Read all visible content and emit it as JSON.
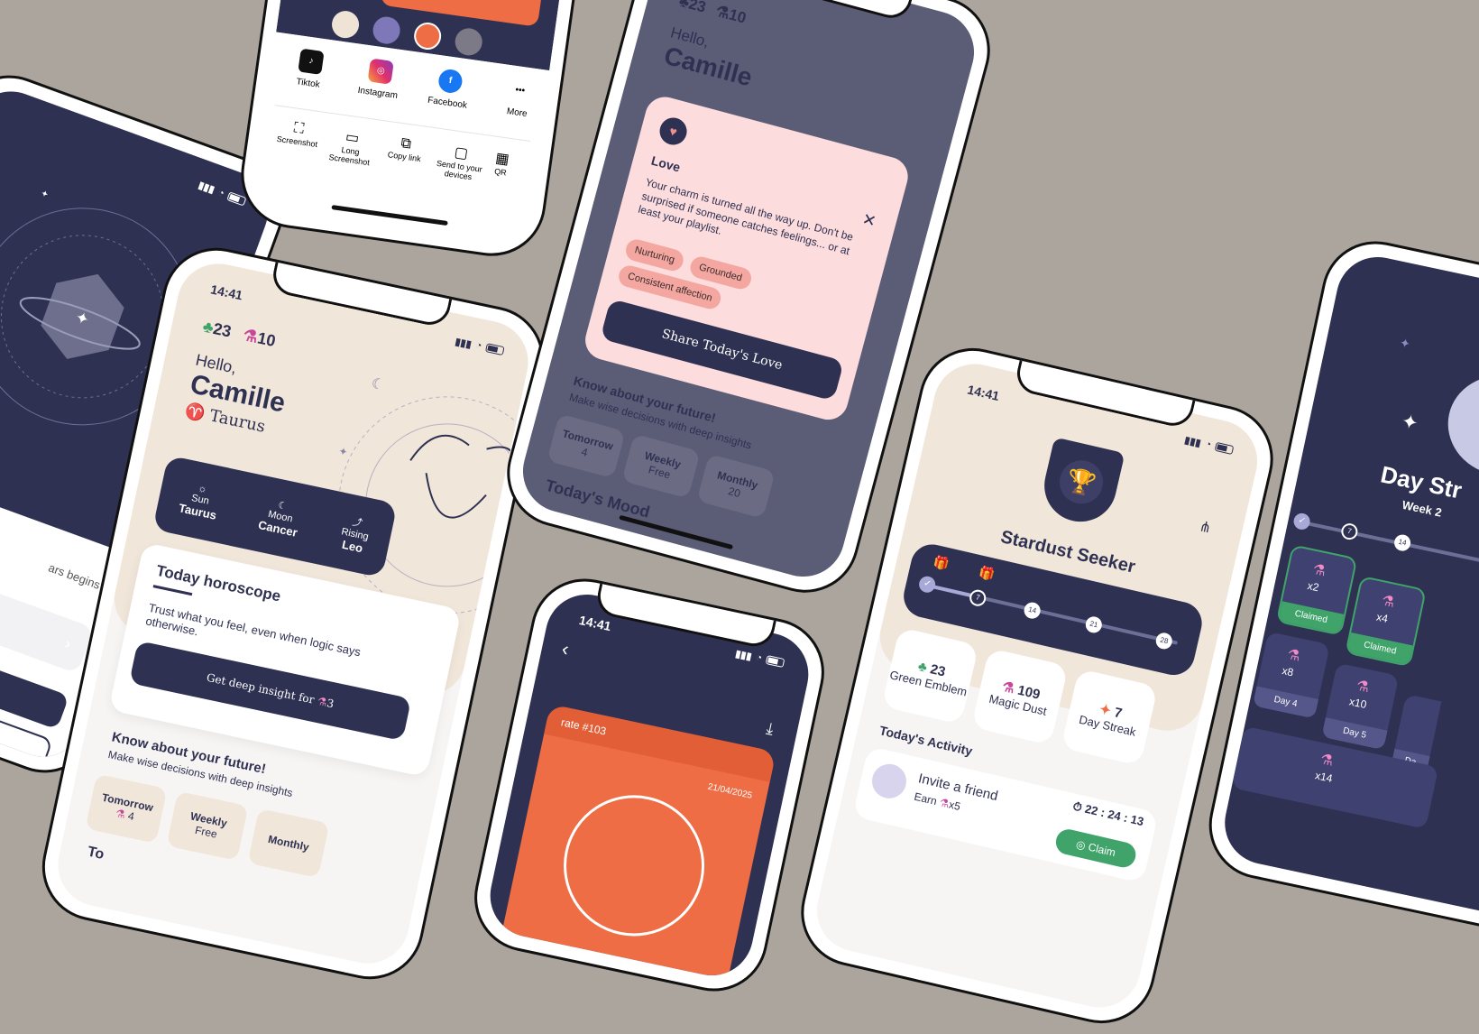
{
  "phone_left": {},
  "share_sheet": {
    "apps": [
      {
        "label": "Tiktok",
        "icon": "tiktok-icon"
      },
      {
        "label": "Instagram",
        "icon": "instagram-icon"
      },
      {
        "label": "Facebook",
        "icon": "facebook-icon"
      },
      {
        "label": "More",
        "icon": "more-icon"
      }
    ],
    "actions": [
      {
        "label": "Screenshot",
        "icon": "screenshot-icon"
      },
      {
        "label": "Long Screenshot",
        "icon": "long-screenshot-icon"
      },
      {
        "label": "Copy link",
        "icon": "copy-link-icon"
      },
      {
        "label": "Send to your devices",
        "icon": "devices-icon"
      },
      {
        "label": "QR",
        "icon": "qr-icon"
      }
    ],
    "swatches": [
      "#efe3d6",
      "#7e78b8",
      "#ee6d45",
      "#7c7a86"
    ]
  },
  "home": {
    "time": "14:41",
    "gems": "23",
    "dust": "10",
    "greeting": "Hello,",
    "name": "Camille",
    "sign": "Taurus",
    "signs": [
      {
        "label": "Sun",
        "value": "Taurus"
      },
      {
        "label": "Moon",
        "value": "Cancer"
      },
      {
        "label": "Rising",
        "value": "Leo"
      }
    ],
    "horoscope_title": "Today horoscope",
    "horoscope_text": "Trust what you feel, even when logic says otherwise.",
    "insight_button": "Get deep insight for",
    "insight_cost": "3",
    "future_title": "Know about your future!",
    "future_sub": "Make wise decisions with deep insights",
    "future_cards": [
      {
        "label": "Tomorrow",
        "value": "4"
      },
      {
        "label": "Weekly",
        "value": "Free"
      },
      {
        "label": "Monthly",
        "value": ""
      }
    ],
    "footer_partial": "To"
  },
  "love_modal": {
    "gems": "23",
    "dust": "10",
    "greeting": "Hello,",
    "name": "Camille",
    "title": "Love",
    "text": "Your charm is turned all the way up. Don't be surprised if someone catches feelings... or at least your playlist.",
    "chips": [
      "Nurturing",
      "Grounded",
      "Consistent affection"
    ],
    "share_button": "Share Today's Love",
    "future_title": "Know about your future!",
    "future_sub": "Make wise decisions with deep insights",
    "future_cards": [
      {
        "label": "Tomorrow",
        "value": "4"
      },
      {
        "label": "Weekly",
        "value": "Free"
      },
      {
        "label": "Monthly",
        "value": "20"
      }
    ],
    "mood_title": "Today's Mood"
  },
  "rate_card": {
    "time": "14:41",
    "rate_label": "rate #103",
    "date": "21/04/2025"
  },
  "stardust": {
    "time": "14:41",
    "title": "Stardust Seeker",
    "milestones": [
      "7",
      "14",
      "21",
      "28"
    ],
    "stats": [
      {
        "value": "23",
        "label": "Green Emblem"
      },
      {
        "value": "109",
        "label": "Magic Dust"
      },
      {
        "value": "7",
        "label": "Day Streak"
      }
    ],
    "activity_title": "Today's Activity",
    "activity_item": "Invite a friend",
    "activity_earn": "Earn",
    "activity_reward": "x5",
    "timer": "22 : 24 : 13",
    "claim": "Claim"
  },
  "streak": {
    "title": "Day Str",
    "week": "Week 2",
    "milestones": [
      "7",
      "14"
    ],
    "rewards": [
      {
        "mult": "x2",
        "status": "Claimed"
      },
      {
        "mult": "x4",
        "status": "Claimed"
      },
      {
        "mult": "x8",
        "status": "Day 4"
      },
      {
        "mult": "x10",
        "status": "Day 5"
      },
      {
        "mult": "",
        "status": "Da"
      },
      {
        "mult": "x14",
        "status": ""
      }
    ]
  },
  "colors": {
    "navy": "#2f3152",
    "cream": "#f1e6da",
    "orange": "#ee6d45",
    "pink": "#fcdcdc",
    "chip": "#f4a7a0",
    "green": "#3fa36a",
    "background": "#aba59d"
  }
}
